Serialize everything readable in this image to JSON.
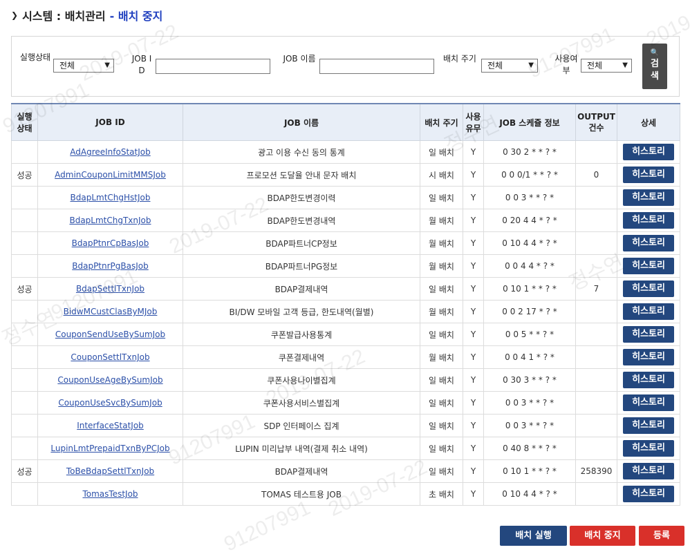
{
  "header": {
    "title": "시스템 : 배치관리",
    "subtitle": "- 배치 중지"
  },
  "search": {
    "status_label": "실행상태",
    "status_value": "전체",
    "jobid_label": "JOB ID",
    "jobid_value": "",
    "jobname_label": "JOB 이름",
    "jobname_value": "",
    "cycle_label": "배치 주기",
    "cycle_value": "전체",
    "use_label": "사용여부",
    "use_value": "전체",
    "search_button": "검색"
  },
  "table": {
    "columns": [
      "실행상태",
      "JOB ID",
      "JOB 이름",
      "배치 주기",
      "사용유무",
      "JOB 스케쥴 정보",
      "OUTPUT건수",
      "상세"
    ],
    "history_label": "히스토리",
    "rows": [
      {
        "status": "",
        "job_id": "AdAgreeInfoStatJob",
        "job_name": "광고 이용 수신 동의 통계",
        "cycle": "일 배치",
        "use": "Y",
        "schedule": "0 30 2 * * ? *",
        "output": ""
      },
      {
        "status": "성공",
        "job_id": "AdminCouponLimitMMSJob",
        "job_name": "프로모션 도달율 안내 문자 배치",
        "cycle": "시 배치",
        "use": "Y",
        "schedule": "0 0 0/1 * * ? *",
        "output": "0"
      },
      {
        "status": "",
        "job_id": "BdapLmtChgHstJob",
        "job_name": "BDAP한도변경이력",
        "cycle": "일 배치",
        "use": "Y",
        "schedule": "0 0 3 * * ? *",
        "output": ""
      },
      {
        "status": "",
        "job_id": "BdapLmtChgTxnJob",
        "job_name": "BDAP한도변경내역",
        "cycle": "월 배치",
        "use": "Y",
        "schedule": "0 20 4 4 * ? *",
        "output": ""
      },
      {
        "status": "",
        "job_id": "BdapPtnrCpBasJob",
        "job_name": "BDAP파트너CP정보",
        "cycle": "월 배치",
        "use": "Y",
        "schedule": "0 10 4 4 * ? *",
        "output": ""
      },
      {
        "status": "",
        "job_id": "BdapPtnrPgBasJob",
        "job_name": "BDAP파트너PG정보",
        "cycle": "월 배치",
        "use": "Y",
        "schedule": "0 0 4 4 * ? *",
        "output": ""
      },
      {
        "status": "성공",
        "job_id": "BdapSettlTxnJob",
        "job_name": "BDAP결제내역",
        "cycle": "일 배치",
        "use": "Y",
        "schedule": "0 10 1 * * ? *",
        "output": "7"
      },
      {
        "status": "",
        "job_id": "BidwMCustClasByMJob",
        "job_name": "BI/DW 모바일 고객 등급, 한도내역(월별)",
        "cycle": "월 배치",
        "use": "Y",
        "schedule": "0 0 2 17 * ? *",
        "output": ""
      },
      {
        "status": "",
        "job_id": "CouponSendUseBySumJob",
        "job_name": "쿠폰발급사용통계",
        "cycle": "일 배치",
        "use": "Y",
        "schedule": "0 0 5 * * ? *",
        "output": ""
      },
      {
        "status": "",
        "job_id": "CouponSettlTxnJob",
        "job_name": "쿠폰결제내역",
        "cycle": "월 배치",
        "use": "Y",
        "schedule": "0 0 4 1 * ? *",
        "output": ""
      },
      {
        "status": "",
        "job_id": "CouponUseAgeBySumJob",
        "job_name": "쿠폰사용나이별집계",
        "cycle": "일 배치",
        "use": "Y",
        "schedule": "0 30 3 * * ? *",
        "output": ""
      },
      {
        "status": "",
        "job_id": "CouponUseSvcBySumJob",
        "job_name": "쿠폰사용서비스별집계",
        "cycle": "일 배치",
        "use": "Y",
        "schedule": "0 0 3 * * ? *",
        "output": ""
      },
      {
        "status": "",
        "job_id": "InterfaceStatJob",
        "job_name": "SDP 인터페이스 집계",
        "cycle": "일 배치",
        "use": "Y",
        "schedule": "0 0 3 * * ? *",
        "output": ""
      },
      {
        "status": "",
        "job_id": "LupinLmtPrepaidTxnByPCJob",
        "job_name": "LUPIN 미리납부 내역(결제 취소 내역)",
        "cycle": "일 배치",
        "use": "Y",
        "schedule": "0 40 8 * * ? *",
        "output": ""
      },
      {
        "status": "성공",
        "job_id": "ToBeBdapSettlTxnJob",
        "job_name": "BDAP결제내역",
        "cycle": "일 배치",
        "use": "Y",
        "schedule": "0 10 1 * * ? *",
        "output": "258390"
      },
      {
        "status": "",
        "job_id": "TomasTestJob",
        "job_name": "TOMAS 테스트용 JOB",
        "cycle": "초 배치",
        "use": "Y",
        "schedule": "0 10 4 4 * ? *",
        "output": ""
      }
    ]
  },
  "footer": {
    "run_button": "배치 실행",
    "stop_button": "배치 중지",
    "register_button": "등록"
  },
  "watermark": {
    "texts": [
      "2019-07-22",
      "91207991",
      "정수연"
    ]
  }
}
